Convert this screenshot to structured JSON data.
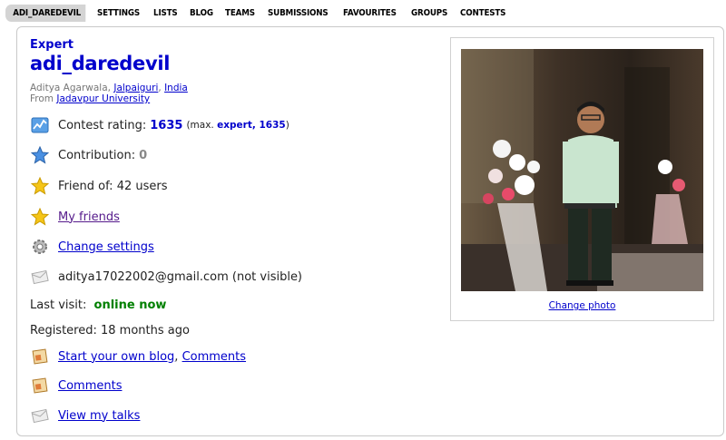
{
  "menu": {
    "items": [
      {
        "label": "ADI_DAREDEVIL",
        "active": true
      },
      {
        "label": "SETTINGS"
      },
      {
        "label": "LISTS"
      },
      {
        "label": "BLOG"
      },
      {
        "label": "TEAMS"
      },
      {
        "label": "SUBMISSIONS"
      },
      {
        "label": "FAVOURITES"
      },
      {
        "label": "GROUPS"
      },
      {
        "label": "CONTESTS"
      }
    ]
  },
  "profile": {
    "rank": "Expert",
    "handle": "adi_daredevil",
    "name": "Aditya Agarwala,",
    "city": "Jalpaiguri",
    "country": "India",
    "from_label": "From",
    "organization": "Jadavpur University",
    "rating_label": "Contest rating:",
    "rating_value": "1635",
    "rating_max_prefix": "(max.",
    "rating_max_rank": "expert, 1635",
    "rating_max_suffix": ")",
    "contribution_label": "Contribution:",
    "contribution_value": "0",
    "friend_of": "Friend of: 42 users",
    "my_friends": "My friends",
    "change_settings": "Change settings",
    "email": "aditya17022002@gmail.com (not visible)",
    "last_visit_label": "Last visit:",
    "last_visit_value": "online now",
    "registered": "Registered: 18 months ago",
    "start_blog": "Start your own blog",
    "blog_sep": ",",
    "comments_link_1": "Comments",
    "comments_link_2": "Comments",
    "view_talks": "View my talks",
    "change_photo": "Change photo"
  },
  "icons": {
    "rating": "chart-icon",
    "contribution": "blue-star-icon",
    "friend_of": "star-icon",
    "my_friends": "star-icon",
    "settings": "gear-icon",
    "email": "envelope-icon",
    "blog": "blog-icon",
    "comments": "blog-icon",
    "talks": "envelope-icon"
  },
  "colors": {
    "expert_blue": "#0000cc",
    "online_green": "#008000",
    "link_purple": "#551a8b"
  }
}
